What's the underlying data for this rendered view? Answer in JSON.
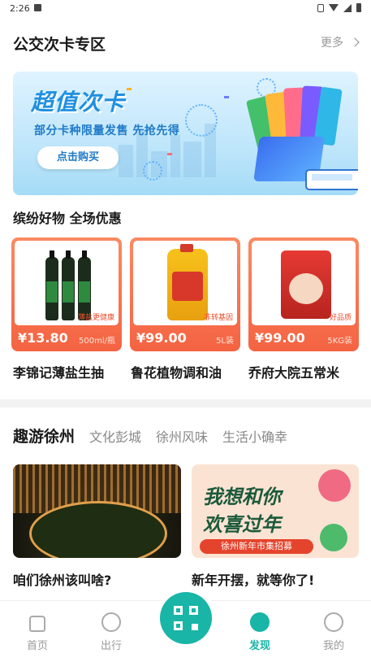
{
  "status_bar": {
    "time": "2:26"
  },
  "section": {
    "title": "公交次卡专区",
    "more_label": "更多"
  },
  "banner": {
    "title": "超值次卡",
    "subtitle": "部分卡种限量发售 先抢先得",
    "button_label": "点击购买"
  },
  "promo": {
    "heading": "缤纷好物 全场优惠"
  },
  "products": [
    {
      "name": "李锦记薄盐生抽",
      "price": "¥13.80",
      "unit": "500ml/瓶",
      "tag": "薄盐更健康"
    },
    {
      "name": "鲁花植物调和油",
      "price": "¥99.00",
      "unit": "5L装",
      "tag": "非转基因"
    },
    {
      "name": "乔府大院五常米",
      "price": "¥99.00",
      "unit": "5KG装",
      "tag": "好品质"
    }
  ],
  "tabs": {
    "active": "趣游徐州",
    "items": [
      "文化彭城",
      "徐州风味",
      "生活小确幸"
    ]
  },
  "feed": [
    {
      "title": "咱们徐州该叫啥?"
    },
    {
      "title": "新年开摆，就等你了!",
      "image_line1": "我想和你",
      "image_line2": "欢喜过年",
      "image_ribbon": "徐州新年市集招募"
    }
  ],
  "nav": {
    "home": "首页",
    "travel": "出行",
    "discover": "发现",
    "mine": "我的"
  },
  "colors": {
    "accent": "#19b5a7",
    "product_border": "#f46342"
  }
}
